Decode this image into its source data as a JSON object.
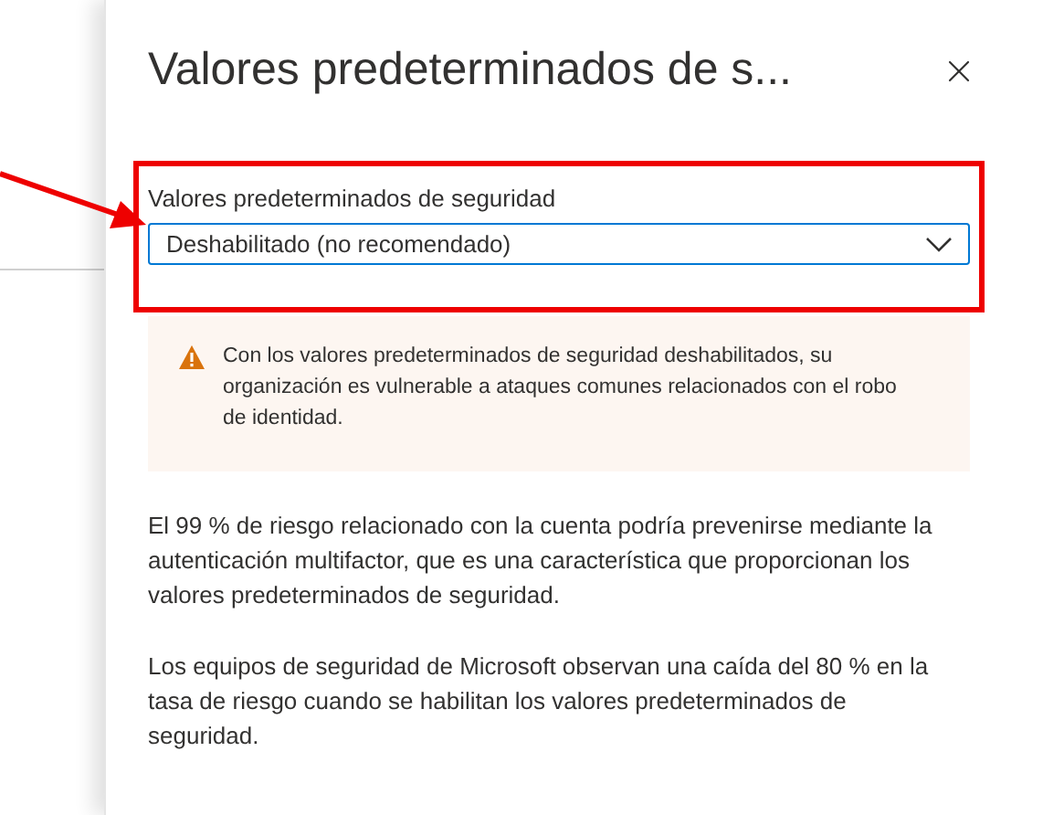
{
  "panel": {
    "title": "Valores predeterminados de s...",
    "field": {
      "label": "Valores predeterminados de seguridad",
      "value": "Deshabilitado (no recomendado)"
    },
    "warning": "Con los valores predeterminados de seguridad deshabilitados, su organización es vulnerable a ataques comunes relacionados con el robo de identidad.",
    "paragraphs": [
      "El 99 % de riesgo relacionado con la cuenta podría prevenirse mediante la autenticación multifactor, que es una característica que proporcionan los valores predeterminados de seguridad.",
      "Los equipos de seguridad de Microsoft observan una caída del 80 % en la tasa de riesgo cuando se habilitan los valores predeterminados de seguridad."
    ]
  }
}
